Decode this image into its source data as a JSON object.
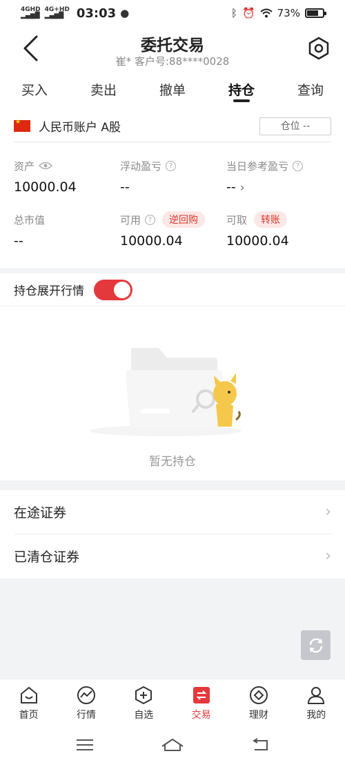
{
  "status_bar": {
    "signal_1": "4GHD",
    "signal_2": "4G+HD",
    "time": "03:03",
    "battery_text": "73%",
    "battery_level": 0.73
  },
  "header": {
    "title": "委托交易",
    "subtitle": "崔* 客户号:88****0028"
  },
  "tabs": [
    {
      "label": "买入",
      "active": false
    },
    {
      "label": "卖出",
      "active": false
    },
    {
      "label": "撤单",
      "active": false
    },
    {
      "label": "持仓",
      "active": true
    },
    {
      "label": "查询",
      "active": false
    }
  ],
  "account": {
    "name": "人民币账户 A股",
    "position_label": "仓位 --"
  },
  "stats": {
    "assets": {
      "label": "资产",
      "value": "10000.04"
    },
    "floating_pnl": {
      "label": "浮动盈亏",
      "value": "--"
    },
    "daily_pnl": {
      "label": "当日参考盈亏",
      "value": "--"
    },
    "market_value": {
      "label": "总市值",
      "value": "--"
    },
    "available": {
      "label": "可用",
      "value": "10000.04",
      "pill": "逆回购"
    },
    "withdrawable": {
      "label": "可取",
      "value": "10000.04",
      "pill": "转账"
    }
  },
  "toggle": {
    "label": "持仓展开行情",
    "on": true
  },
  "empty": {
    "text": "暂无持仓"
  },
  "list": [
    {
      "label": "在途证券"
    },
    {
      "label": "已清仓证券"
    }
  ],
  "bottom_nav": [
    {
      "label": "首页",
      "icon": "home-icon",
      "active": false
    },
    {
      "label": "行情",
      "icon": "chart-icon",
      "active": false
    },
    {
      "label": "自选",
      "icon": "plus-icon",
      "active": false
    },
    {
      "label": "交易",
      "icon": "trade-icon",
      "active": true
    },
    {
      "label": "理财",
      "icon": "wealth-icon",
      "active": false
    },
    {
      "label": "我的",
      "icon": "profile-icon",
      "active": false
    }
  ],
  "colors": {
    "accent": "#e4393c",
    "pill_bg": "#fce8e6"
  }
}
